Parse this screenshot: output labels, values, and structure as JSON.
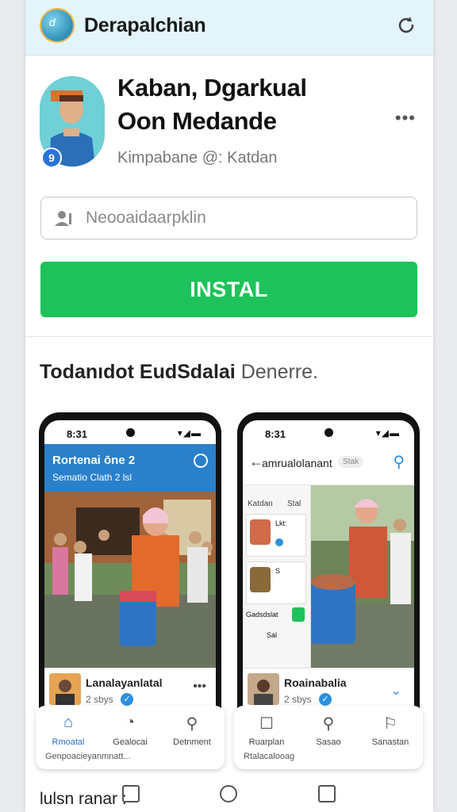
{
  "header": {
    "title": "Derapalchian",
    "logo_text": "d"
  },
  "profile": {
    "name_line1": "Kaban, Dgarkual",
    "name_line2": "Oon Medande",
    "subtitle": "Kimpabane @: Katdan",
    "badge": "9",
    "more": "•••"
  },
  "search": {
    "placeholder": "Neooaidaarpklin"
  },
  "install": {
    "label": "INSTAL"
  },
  "section": {
    "title_bold": "Todanıdot EudSdalai",
    "title_rest": "Denerre."
  },
  "phone1": {
    "time": "8:31",
    "status_icons": "▾◢▬",
    "bar_title": "Rortenai ōne 2",
    "bar_sub": "Sematio Clath 2 lsl",
    "card_name": "Lanalayanlatal",
    "card_date": "2 sbys",
    "card_more": "•••",
    "nav": [
      {
        "label": "Rmoatal",
        "icon": "⌂"
      },
      {
        "label": "Gealocai",
        "icon": "◔"
      },
      {
        "label": "Detnment",
        "icon": "⚲"
      }
    ],
    "footer": "Genpoacieyanmnatt..."
  },
  "phone2": {
    "time": "8:31",
    "status_icons": "▾◢▬",
    "bar_title": "amrualolanant",
    "bar_chip": "Stak",
    "side_items": [
      "Katdan",
      "Stal"
    ],
    "side_labels": [
      "Lkt:",
      "S",
      "Gadsdslat",
      "Sal"
    ],
    "card_name": "Roainabalia",
    "card_date": "2 sbys",
    "nav": [
      {
        "label": "Ruarplan",
        "icon": "☐"
      },
      {
        "label": "Sasao",
        "icon": "⚲"
      },
      {
        "label": "Sanastan",
        "icon": "⚐"
      }
    ],
    "footer": "Rtalacalooag"
  },
  "bottom": {
    "text": "lulsn ranar :"
  },
  "colors": {
    "accent_green": "#1ec25a",
    "header_bg": "#e3f4fb",
    "blue": "#2a80c9"
  }
}
